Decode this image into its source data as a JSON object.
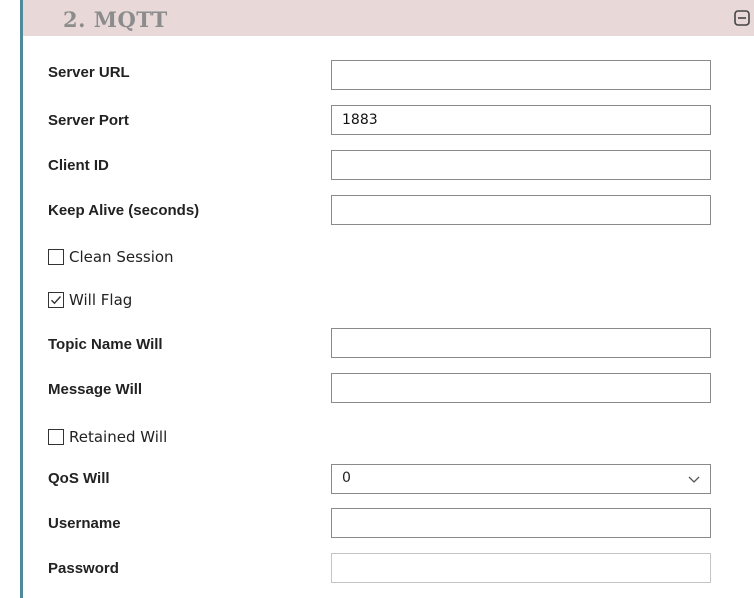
{
  "section": {
    "title": "2. MQTT",
    "collapse_icon": "minus-square-icon"
  },
  "fields": {
    "server_url": {
      "label": "Server URL",
      "value": ""
    },
    "server_port": {
      "label": "Server Port",
      "value": "1883"
    },
    "client_id": {
      "label": "Client ID",
      "value": ""
    },
    "keep_alive": {
      "label": "Keep Alive (seconds)",
      "value": ""
    },
    "topic_name_will": {
      "label": "Topic Name Will",
      "value": ""
    },
    "message_will": {
      "label": "Message Will",
      "value": ""
    },
    "qos_will": {
      "label": "QoS Will",
      "value": "0"
    },
    "username": {
      "label": "Username",
      "value": ""
    },
    "password": {
      "label": "Password",
      "value": ""
    }
  },
  "checkboxes": {
    "clean_session": {
      "label": "Clean Session",
      "checked": false
    },
    "will_flag": {
      "label": "Will Flag",
      "checked": true
    },
    "retained_will": {
      "label": "Retained Will",
      "checked": false
    }
  }
}
